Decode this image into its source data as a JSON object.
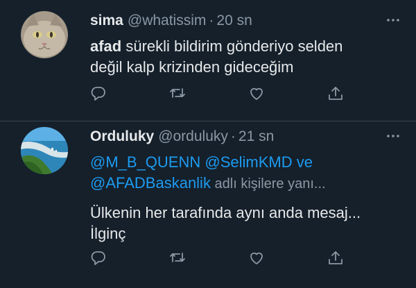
{
  "tweets": [
    {
      "name": "sima",
      "handle": "@whatissim",
      "separator": "·",
      "time": "20 sn",
      "text_bold": "afad",
      "text_rest": " sürekli bildirim gönderiyo selden",
      "text_line2": "değil kalp krizinden gideceğim"
    },
    {
      "name": "Orduluky",
      "handle": "@orduluky",
      "separator": "·",
      "time": "21 sn",
      "mention1": "@M_B_QUENN",
      "mention2": "@SelimKMD",
      "connector": " ve",
      "mention3": "@AFADBaskanlik",
      "reply_suffix": " adlı kişilere yanı...",
      "text_line1": "Ülkenin her tarafında aynı anda mesaj...",
      "text_line2": "İlginç"
    }
  ],
  "icons": {
    "more": "more-horizontal-icon",
    "reply": "reply-icon",
    "retweet": "retweet-icon",
    "like": "like-icon",
    "share": "share-icon"
  },
  "colors": {
    "background": "#15202b",
    "text": "#e7e9ea",
    "muted": "#8b98a5",
    "mention": "#1d9bf0",
    "divider": "#38444d"
  }
}
